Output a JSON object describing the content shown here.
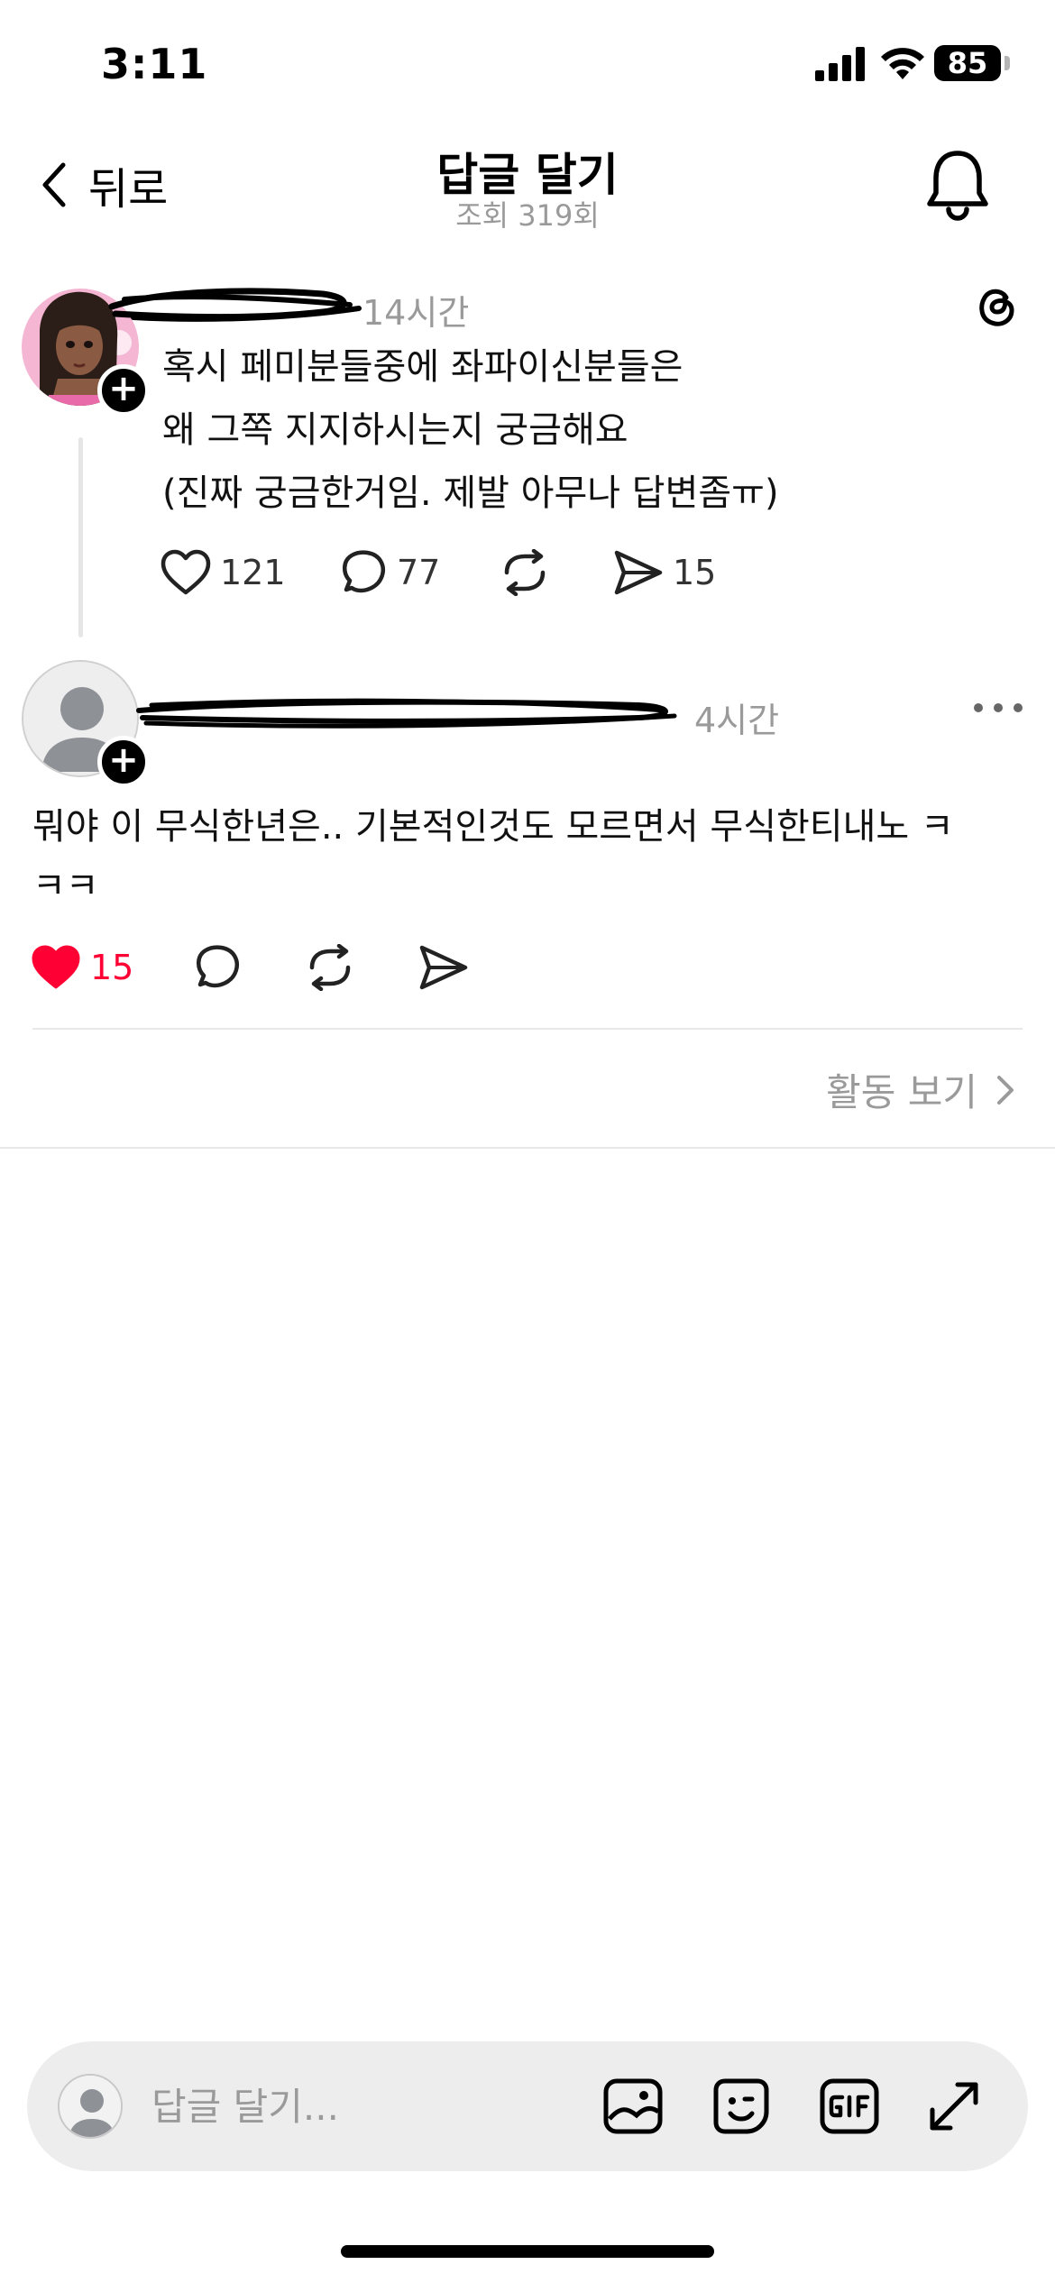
{
  "status_bar": {
    "time": "3:11",
    "battery": "85"
  },
  "nav": {
    "back_label": "뒤로",
    "title": "답글 달기",
    "subtitle": "조회 319회"
  },
  "original_post": {
    "username_hidden": true,
    "time": "14시간",
    "lines": [
      "혹시 페미분들중에 좌파이신분들은",
      "왜 그쪽 지지하시는지 궁금해요",
      "(진짜 궁금한거임. 제발 아무나 답변좀ㅠ)"
    ],
    "likes": "121",
    "comments": "77",
    "shares": "15"
  },
  "reply_post": {
    "username_hidden": true,
    "time": "4시간",
    "lines": [
      "뭐야 이 무식한년은.. 기본적인것도 모르면서 무식한티내노 ㅋ",
      "ㅋㅋ"
    ],
    "likes": "15",
    "liked": true
  },
  "activity_link": "활동 보기",
  "reply_bar": {
    "placeholder": "답글 달기..."
  },
  "colors": {
    "like_red": "#ff0034",
    "muted_gray": "#9a9a9a",
    "divider": "#e8e8e8"
  }
}
